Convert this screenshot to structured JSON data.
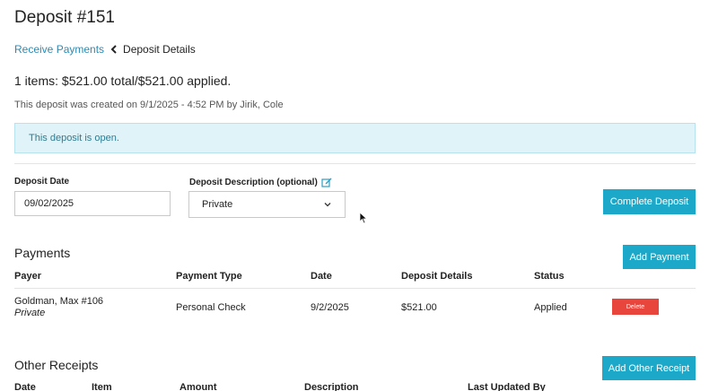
{
  "page": {
    "title": "Deposit #151"
  },
  "breadcrumb": {
    "parent": "Receive Payments",
    "current": "Deposit Details"
  },
  "summary": {
    "text": "1 items: $521.00 total/$521.00 applied.",
    "created": "This deposit was created on 9/1/2025 - 4:52 PM by Jirik, Cole"
  },
  "alert": {
    "text": "This deposit is open."
  },
  "form": {
    "date_label": "Deposit Date",
    "date_value": "09/02/2025",
    "description_label": "Deposit Description (optional)",
    "description_value": "Private",
    "complete_button": "Complete Deposit"
  },
  "payments": {
    "title": "Payments",
    "add_button": "Add Payment",
    "columns": [
      "Payer",
      "Payment Type",
      "Date",
      "Deposit Details",
      "Status"
    ],
    "rows": [
      {
        "payer": "Goldman, Max #106",
        "payer_note": "Private",
        "type": "Personal Check",
        "date": "9/2/2025",
        "details": "$521.00",
        "status": "Applied",
        "delete": "Delete"
      }
    ]
  },
  "other_receipts": {
    "title": "Other Receipts",
    "add_button": "Add Other Receipt",
    "columns": [
      "Date",
      "Item",
      "Amount",
      "Description",
      "Last Updated By"
    ]
  },
  "colors": {
    "accent": "#1ca9c9",
    "link": "#2a8bb5",
    "danger": "#e8453c",
    "alert_bg": "#dff3f8"
  }
}
